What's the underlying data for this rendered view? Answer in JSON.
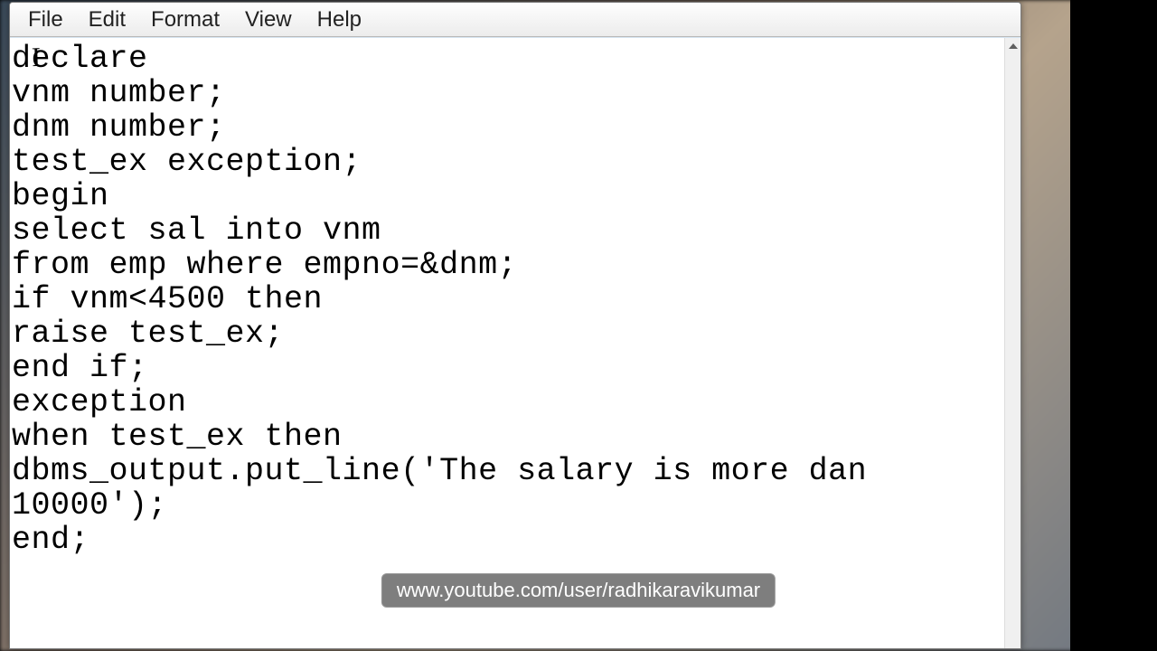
{
  "menu": {
    "file": "File",
    "edit": "Edit",
    "format": "Format",
    "view": "View",
    "help": "Help"
  },
  "editor": {
    "content": "declare\nvnm number;\ndnm number;\ntest_ex exception;\nbegin\nselect sal into vnm\nfrom emp where empno=&dnm;\nif vnm<4500 then\nraise test_ex;\nend if;\nexception\nwhen test_ex then\ndbms_output.put_line('The salary is more dan 10000');\nend;"
  },
  "watermark": {
    "text": "www.youtube.com/user/radhikaravikumar"
  }
}
